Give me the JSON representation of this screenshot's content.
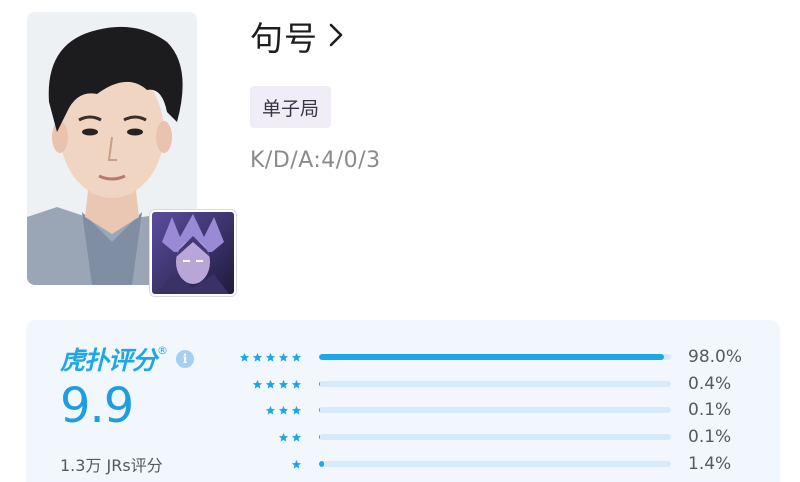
{
  "player": {
    "name": "句号",
    "role_tag": "单子局",
    "kda": "K/D/A:4/0/3"
  },
  "rating": {
    "brand": "虎扑评分",
    "score": "9.9",
    "count": "1.3万 JRs评分",
    "accent_color": "#1ea7e4",
    "distribution": [
      {
        "stars": 5,
        "percent_label": "98.0%",
        "fraction": 0.98
      },
      {
        "stars": 4,
        "percent_label": "0.4%",
        "fraction": 0.004
      },
      {
        "stars": 3,
        "percent_label": "0.1%",
        "fraction": 0.001
      },
      {
        "stars": 2,
        "percent_label": "0.1%",
        "fraction": 0.001
      },
      {
        "stars": 1,
        "percent_label": "1.4%",
        "fraction": 0.014
      }
    ]
  },
  "icons": {
    "chevron": "chevron-right-icon",
    "info": "info-icon",
    "star": "star-icon"
  }
}
